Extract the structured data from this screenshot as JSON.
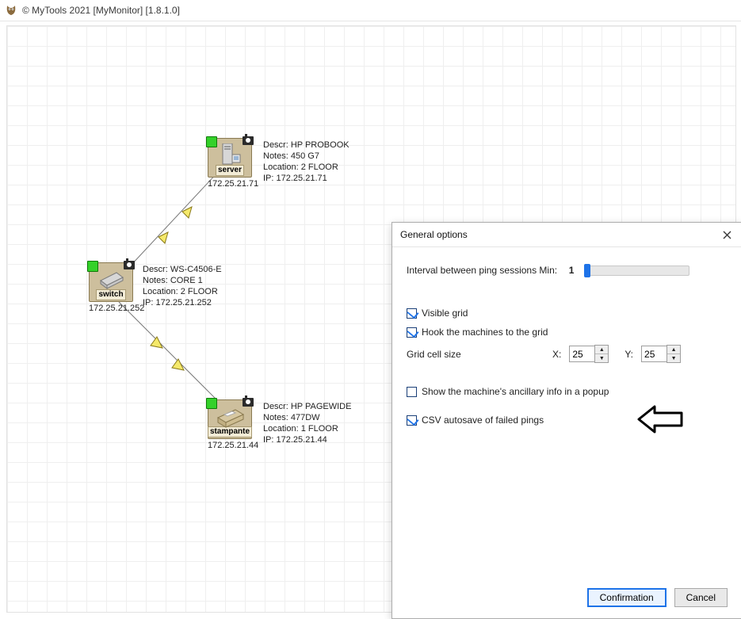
{
  "titlebar": {
    "text": "© MyTools 2021 [MyMonitor] [1.8.1.0]"
  },
  "nodes": {
    "server": {
      "caption": "server",
      "ip": "172.25.21.71",
      "descr": "Descr: HP PROBOOK",
      "notes": "Notes: 450 G7",
      "location": "Location: 2 FLOOR",
      "ip_line": "IP: 172.25.21.71"
    },
    "switch": {
      "caption": "switch",
      "ip": "172.25.21.252",
      "descr": "Descr: WS-C4506-E",
      "notes": "Notes: CORE 1",
      "location": "Location: 2 FLOOR",
      "ip_line": "IP: 172.25.21.252"
    },
    "printer": {
      "caption": "stampante",
      "ip": "172.25.21.44",
      "descr": "Descr: HP PAGEWIDE",
      "notes": "Notes: 477DW",
      "location": "Location: 1 FLOOR",
      "ip_line": "IP: 172.25.21.44"
    }
  },
  "dialog": {
    "title": "General options",
    "interval_label": "Interval between ping sessions  Min:",
    "interval_value": "1",
    "visible_grid": "Visible grid",
    "hook_grid": "Hook the machines to the grid",
    "grid_cell": "Grid cell size",
    "x_label": "X:",
    "x_value": "25",
    "y_label": "Y:",
    "y_value": "25",
    "popup_info": "Show the machine's ancillary info in a popup",
    "csv_autosave": "CSV autosave of failed pings",
    "confirm": "Confirmation",
    "cancel": "Cancel"
  }
}
